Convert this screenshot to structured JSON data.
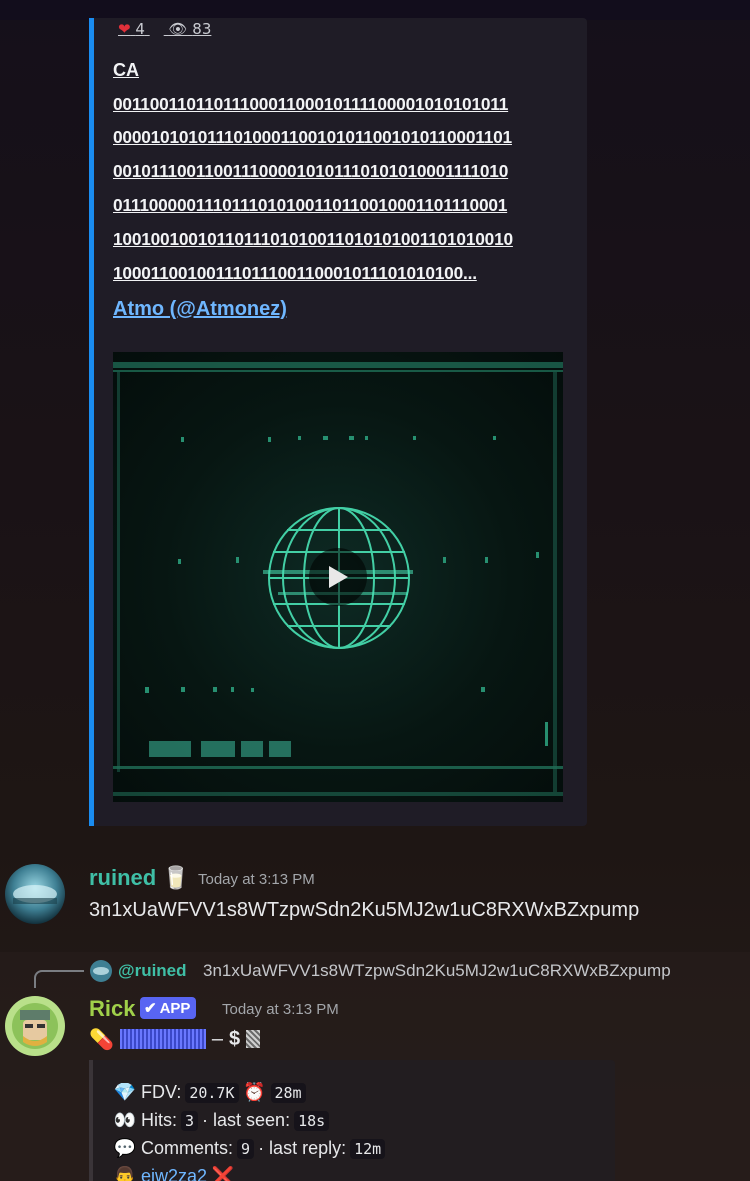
{
  "embed": {
    "likes": "4",
    "views": "83",
    "ca_label": "CA",
    "ca_lines": [
      "0011001101101110001100010111100001010101011",
      "0000101010111010001100101011001010110001101",
      "0010111001100111000010101110101010001111010",
      "0111000001110111010100110110010001101110001",
      "1001001001011011101010011010101001101010010",
      "1000110010011101110011000101110101010​0..."
    ],
    "author": "Atmo (@Atmonez)",
    "video_alt": "play"
  },
  "message1": {
    "username": "ruined",
    "username_emoji": "🥛",
    "timestamp": "Today at 3:13 PM",
    "content": "3n1xUaWFVV1s8WTzpwSdn2Ku5MJ2w1uC8RXWxBZxpump"
  },
  "message2": {
    "reply_to_name": "@ruined",
    "reply_to_text": "3n1xUaWFVV1s8WTzpwSdn2Ku5MJ2w1uC8RXWxBZxpump",
    "username": "Rick",
    "badge": "APP",
    "timestamp": "Today at 3:13 PM",
    "line_pill": "💊",
    "line_dash": "–",
    "line_dollar": "$",
    "rows": {
      "fdv_label": "FDV:",
      "fdv_value": "20.7K",
      "age_value": "28m",
      "hits_label": "Hits:",
      "hits_value": "3",
      "last_seen_label": "· last seen:",
      "last_seen_value": "18s",
      "comments_label": "Comments:",
      "comments_value": "9",
      "last_reply_label": "· last reply:",
      "last_reply_value": "12m",
      "dev_handle": "ejw2za2"
    }
  },
  "colors": {
    "embed_accent": "#1a8cf0",
    "ruined_name": "#3fbfa6",
    "rick_name": "#a0d04a",
    "badge": "#5865f2",
    "link": "#6fb7ff"
  }
}
